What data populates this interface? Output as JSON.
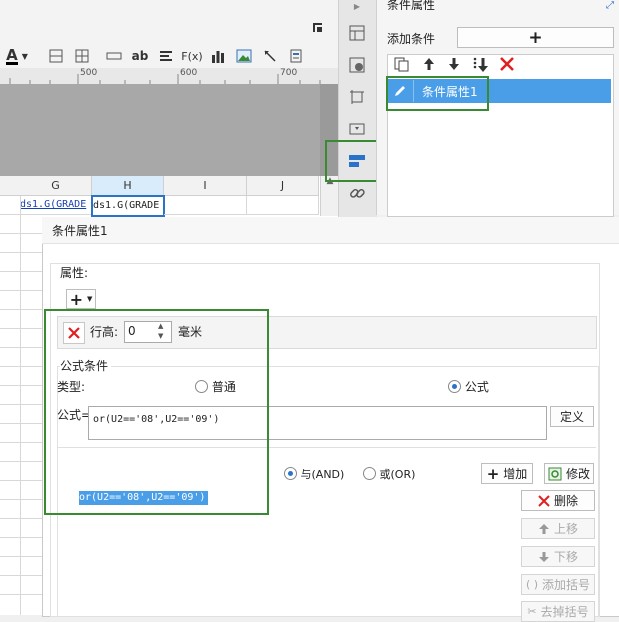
{
  "toolbar": {
    "font_color_label": "A",
    "text_label": "ab",
    "formula_label": "F(x)"
  },
  "ruler": {
    "ticks": [
      "500",
      "600",
      "700"
    ]
  },
  "grid": {
    "columns": [
      "G",
      "H",
      "I",
      "J"
    ],
    "cell_g": "ds1.G(GRADE",
    "cell_h": "ds1.G(GRADE"
  },
  "right_panel": {
    "title": "条件属性",
    "add_condition_label": "添加条件",
    "add_icon": "+",
    "selected_item": "条件属性1"
  },
  "dialog": {
    "title": "条件属性1",
    "attributes_label": "属性:",
    "add_attr_icon": "+",
    "row_height_label": "行高:",
    "row_height_value": "0",
    "unit_label": "毫米",
    "formula_section_label": "公式条件",
    "type_label": "类型:",
    "type_normal": "普通",
    "type_formula": "公式",
    "formula_label": "公式=",
    "formula_value": "or(U2=='08',U2=='09')",
    "define_button": "定义",
    "and_label": "与(AND)",
    "or_label": "或(OR)",
    "add_button": "增加",
    "modify_button": "修改",
    "condition_item": "or(U2=='08',U2=='09')",
    "delete_button": "删除",
    "move_up_button": "上移",
    "move_down_button": "下移",
    "add_bracket_button": "添加括号",
    "remove_bracket_button": "去掉括号"
  },
  "colors": {
    "selection": "#4a9ee8",
    "highlight_box": "#3a8a34",
    "delete_red": "#e02020"
  }
}
